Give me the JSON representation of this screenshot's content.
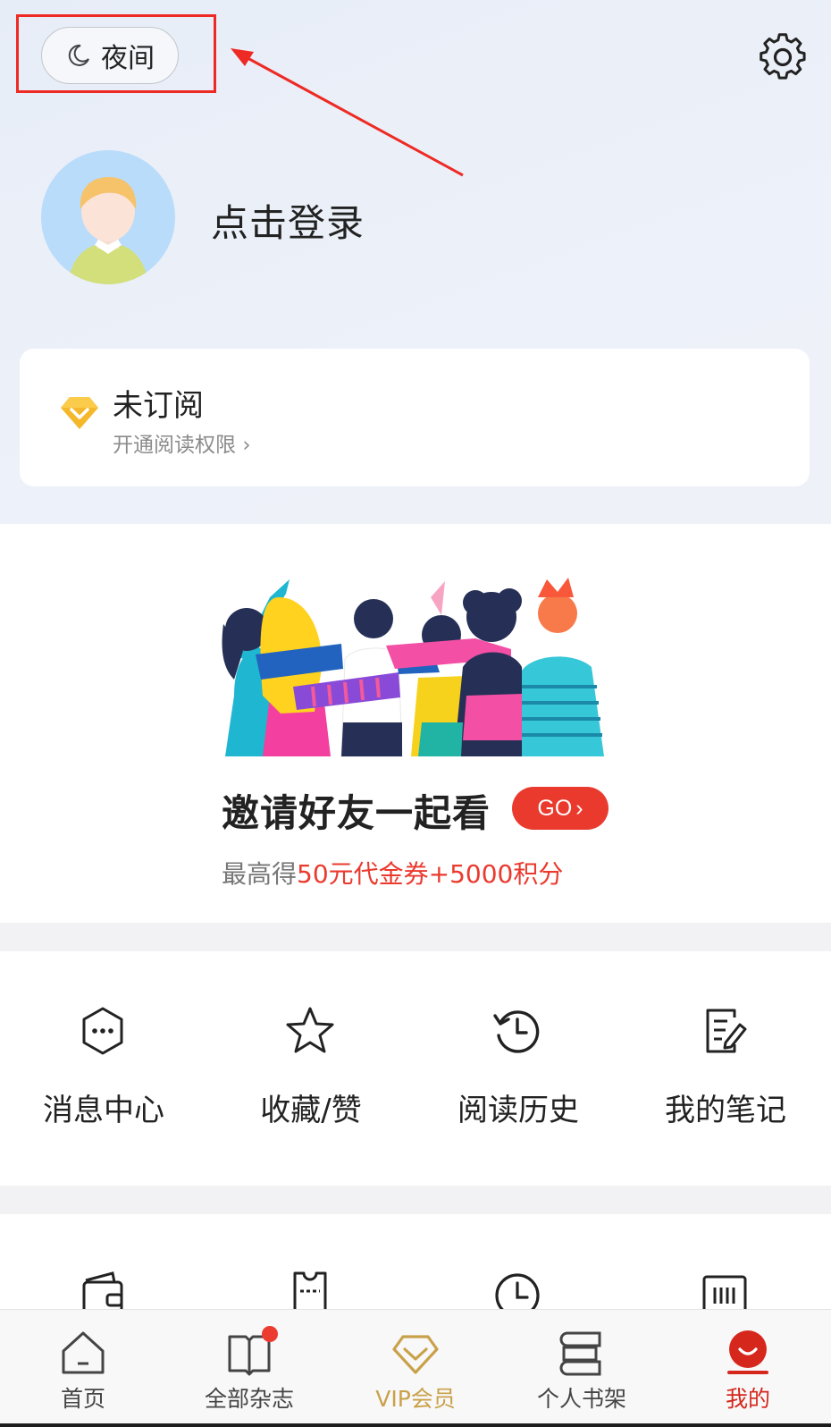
{
  "header": {
    "night_mode_label": "夜间",
    "login_prompt": "点击登录"
  },
  "subscription": {
    "status": "未订阅",
    "link_label": "开通阅读权限",
    "link_chevron": "›"
  },
  "invite": {
    "headline": "邀请好友一起看",
    "go_label": "GO",
    "go_chevron": "›",
    "reward_prefix": "最高得",
    "reward_highlight": "50元代金券+5000积分"
  },
  "features": [
    {
      "label": "消息中心",
      "icon": "message-icon"
    },
    {
      "label": "收藏/赞",
      "icon": "star-icon"
    },
    {
      "label": "阅读历史",
      "icon": "history-icon"
    },
    {
      "label": "我的笔记",
      "icon": "notes-icon"
    }
  ],
  "features_row2": [
    {
      "icon": "wallet-icon"
    },
    {
      "icon": "ticket-icon"
    },
    {
      "icon": "clock-icon"
    },
    {
      "icon": "barcode-icon"
    }
  ],
  "tabbar": {
    "items": [
      {
        "label": "首页",
        "icon": "home-icon"
      },
      {
        "label": "全部杂志",
        "icon": "book-icon",
        "badge": true
      },
      {
        "label": "VIP会员",
        "icon": "vip-diamond-icon"
      },
      {
        "label": "个人书架",
        "icon": "bookshelf-icon"
      },
      {
        "label": "我的",
        "icon": "profile-icon",
        "active": true
      }
    ]
  },
  "colors": {
    "accent_red": "#ea3a2e",
    "vip_gold": "#c9a14a",
    "active_tab": "#d6271d",
    "annotation_red": "#ee2a24"
  }
}
